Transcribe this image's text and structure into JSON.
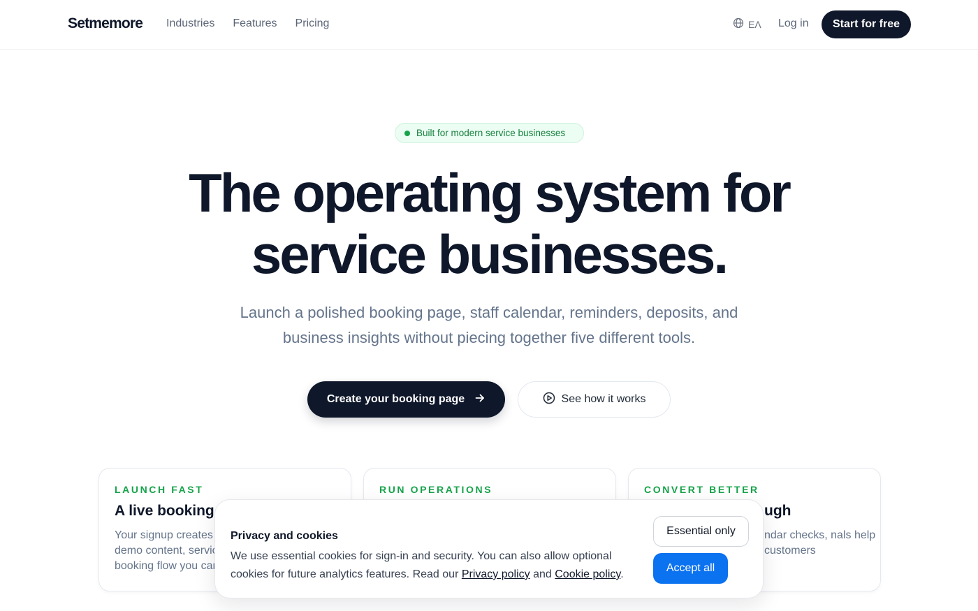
{
  "header": {
    "logo": "Setmemore",
    "nav": [
      "Industries",
      "Features",
      "Pricing"
    ],
    "language": "EΛ",
    "login": "Log in",
    "cta": "Start for free"
  },
  "hero": {
    "badge": "Built for modern service businesses",
    "headline_line1": "The operating system for",
    "headline_line2": "service businesses.",
    "subhead": "Launch a polished booking page, staff calendar, reminders, deposits, and business insights without piecing together five different tools.",
    "primary_cta": "Create your booking page",
    "secondary_cta": "See how it works"
  },
  "cards": [
    {
      "eyebrow": "LAUNCH FAST",
      "title": "A live booking p",
      "body": "Your signup creates demo content, servic booking flow you car"
    },
    {
      "eyebrow": "RUN OPERATIONS",
      "title": "",
      "body": ""
    },
    {
      "eyebrow": "CONVERT BETTER",
      "title": "ugh",
      "body": "ndar checks, nals help customers"
    }
  ],
  "cookie": {
    "title": "Privacy and cookies",
    "body_prefix": "We use essential cookies for sign-in and security. You can also allow optional cookies for future analytics features. Read our ",
    "privacy_link": "Privacy policy",
    "and_text": " and ",
    "cookie_link": "Cookie policy",
    "body_suffix": ".",
    "essential_button": "Essential only",
    "accept_button": "Accept all"
  },
  "colors": {
    "dark": "#0f172a",
    "accent_green": "#16a34a",
    "accent_blue": "#0b72f0"
  }
}
